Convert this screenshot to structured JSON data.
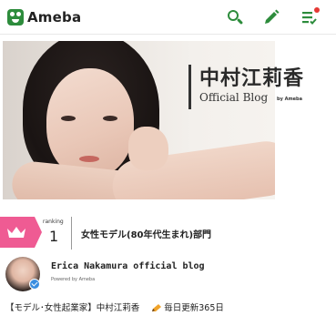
{
  "header": {
    "logo_text": "Ameba",
    "icons": [
      "search-icon",
      "pencil-icon",
      "feed-list-icon"
    ],
    "accent_color": "#2d8c3c",
    "notification_color": "#e53935"
  },
  "banner": {
    "blog_name": "中村江莉香",
    "subtitle": "Official Blog",
    "by_label": "by Ameba"
  },
  "ranking": {
    "label": "ranking",
    "number": "1",
    "category": "女性モデル(80年代生まれ)部門",
    "badge_color": "#ef5b93"
  },
  "profile": {
    "name": "Erica Nakamura official blog",
    "powered_by": "Powered by Ameba",
    "description_left": "【モデル･女性起業家】中村江莉香",
    "description_right": "毎日更新365日"
  }
}
